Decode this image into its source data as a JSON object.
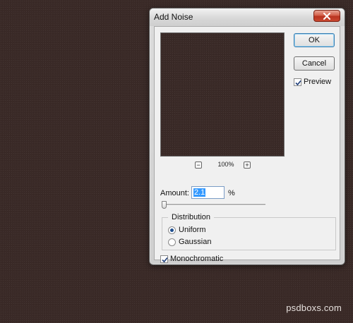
{
  "dialog": {
    "title": "Add Noise",
    "ok_label": "OK",
    "cancel_label": "Cancel",
    "preview_label": "Preview",
    "preview_checked": true,
    "zoom_level": "100%",
    "zoom_out_symbol": "−",
    "zoom_in_symbol": "+",
    "amount_label": "Amount:",
    "amount_value": "2.1",
    "amount_unit": "%",
    "distribution": {
      "legend": "Distribution",
      "options": [
        "Uniform",
        "Gaussian"
      ],
      "selected": "Uniform"
    },
    "monochromatic_label": "Monochromatic",
    "monochromatic_checked": true
  },
  "watermark": "psdboxs.com",
  "colors": {
    "canvas": "#3a2a27",
    "selection": "#3399ff",
    "close_button": "#c9472f"
  },
  "icons": [
    "close-icon",
    "zoom-out-icon",
    "zoom-in-icon",
    "checkmark-icon"
  ]
}
